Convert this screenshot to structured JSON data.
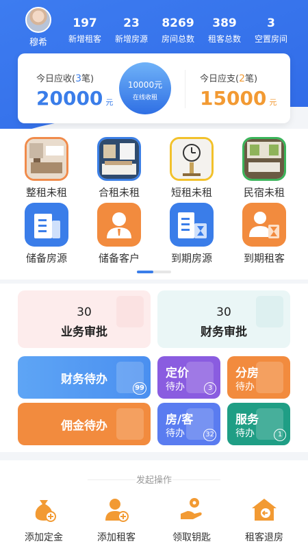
{
  "profile": {
    "name": "穆希"
  },
  "stats": [
    {
      "value": "197",
      "label": "新增租客"
    },
    {
      "value": "23",
      "label": "新增房源"
    },
    {
      "value": "8269",
      "label": "房间总数"
    },
    {
      "value": "389",
      "label": "租客总数"
    },
    {
      "value": "3",
      "label": "空置房间"
    }
  ],
  "finance": {
    "receivable": {
      "prefix": "今日应收(",
      "count": "3",
      "suffix": "笔)",
      "amount": "20000",
      "unit": "元"
    },
    "center": {
      "amount": "10000元",
      "label": "在线收租"
    },
    "payable": {
      "prefix": "今日应支(",
      "count": "2",
      "suffix": "笔)",
      "amount": "15000",
      "unit": "元"
    }
  },
  "grid": [
    {
      "label": "整租未租",
      "icon": "whole-rent-photo-icon"
    },
    {
      "label": "合租未租",
      "icon": "shared-rent-photo-icon"
    },
    {
      "label": "短租未租",
      "icon": "short-rent-photo-icon"
    },
    {
      "label": "民宿未租",
      "icon": "homestay-photo-icon"
    },
    {
      "label": "储备房源",
      "icon": "building-icon"
    },
    {
      "label": "储备客户",
      "icon": "person-icon"
    },
    {
      "label": "到期房源",
      "icon": "building-hourglass-icon"
    },
    {
      "label": "到期租客",
      "icon": "person-hourglass-icon"
    }
  ],
  "approvals": [
    {
      "count": "30",
      "label": "业务审批"
    },
    {
      "count": "30",
      "label": "财务审批"
    }
  ],
  "todos": {
    "finance": {
      "label": "财务待办",
      "badge": "99"
    },
    "pricing": {
      "title": "定价",
      "sub": "待办",
      "badge": "3"
    },
    "allocation": {
      "title": "分房",
      "sub": "待办"
    },
    "commission": {
      "label": "佣金待办"
    },
    "room_tenant": {
      "title": "房/客",
      "sub": "待办",
      "badge": "32"
    },
    "service": {
      "title": "服务",
      "sub": "待办",
      "badge": "1"
    }
  },
  "actions": {
    "title": "发起操作",
    "items": [
      {
        "label": "添加定金",
        "icon": "money-bag-add-icon"
      },
      {
        "label": "添加租客",
        "icon": "person-add-icon"
      },
      {
        "label": "领取钥匙",
        "icon": "hand-key-icon"
      },
      {
        "label": "租客退房",
        "icon": "house-exit-icon"
      }
    ]
  },
  "colors": {
    "primary_blue": "#3a7de9",
    "accent_orange": "#f29a33",
    "purple": "#8a5ce0",
    "green": "#1f9e85"
  }
}
